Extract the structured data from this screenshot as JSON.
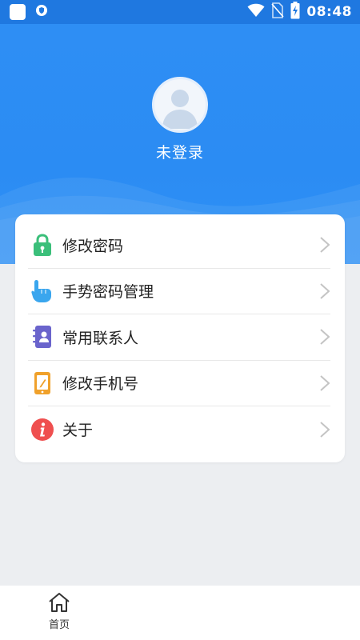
{
  "status_bar": {
    "time": "08:48"
  },
  "profile": {
    "name": "未登录"
  },
  "menu": {
    "items": [
      {
        "label": "修改密码",
        "icon": "lock-icon",
        "color": "#3bbf7a"
      },
      {
        "label": "手势密码管理",
        "icon": "hand-pointer-icon",
        "color": "#3aa6ee"
      },
      {
        "label": "常用联系人",
        "icon": "contacts-book-icon",
        "color": "#6a64cc"
      },
      {
        "label": "修改手机号",
        "icon": "phone-edit-icon",
        "color": "#f0a12b"
      },
      {
        "label": "关于",
        "icon": "info-icon",
        "color": "#ef4f4f"
      }
    ]
  },
  "bottom_nav": {
    "home_label": "首页"
  },
  "colors": {
    "header_blue": "#2b8cf3",
    "status_blue": "#1f78e0",
    "page_bg": "#eceef1"
  }
}
